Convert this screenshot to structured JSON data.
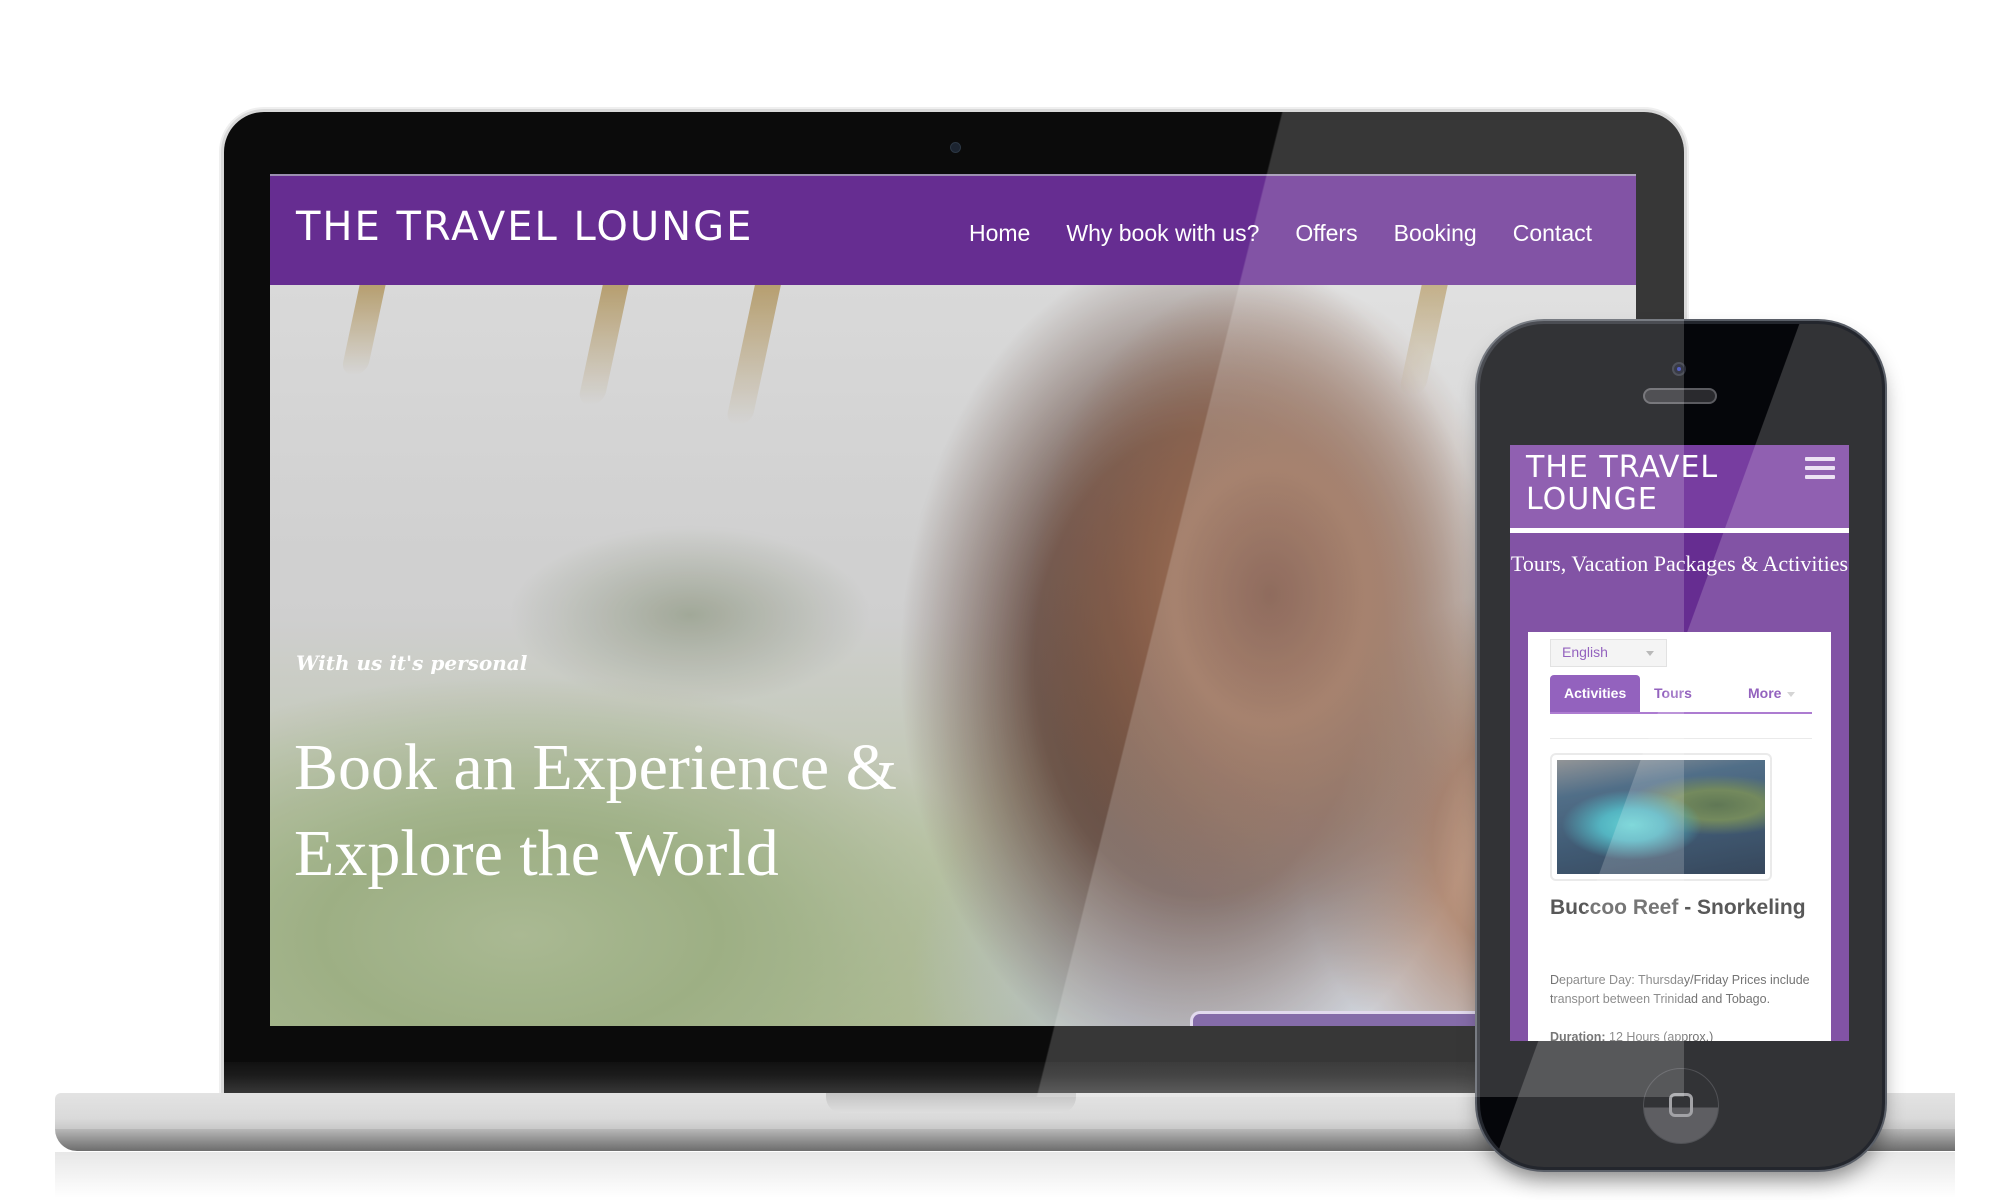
{
  "laptop": {
    "site": {
      "logo": "THE TRAVEL LOUNGE",
      "nav": [
        {
          "label": "Home"
        },
        {
          "label": "Why book with us?"
        },
        {
          "label": "Offers"
        },
        {
          "label": "Booking"
        },
        {
          "label": "Contact"
        }
      ],
      "hero": {
        "tagline": "With us it's personal",
        "heading": "Book an Experience & Explore the World"
      }
    }
  },
  "phone": {
    "site": {
      "logo": "THE TRAVEL LOUNGE",
      "menu_icon": "hamburger-icon",
      "tagline": "Tours, Vacation Packages & Activities",
      "language_select": {
        "value": "English"
      },
      "tabs": [
        {
          "label": "Activities",
          "active": true
        },
        {
          "label": "Tours",
          "active": false
        },
        {
          "label": "More",
          "active": false
        }
      ],
      "listing": {
        "title": "Buccoo Reef - Snorkeling",
        "description": "Departure Day: Thursday/Friday Prices include transport between Trinidad and Tobago.",
        "duration_label": "Duration:",
        "duration_value": "12 Hours (approx.)"
      }
    }
  },
  "colors": {
    "brand_purple": "#662d91",
    "accent_purple": "#7b3fb0"
  }
}
